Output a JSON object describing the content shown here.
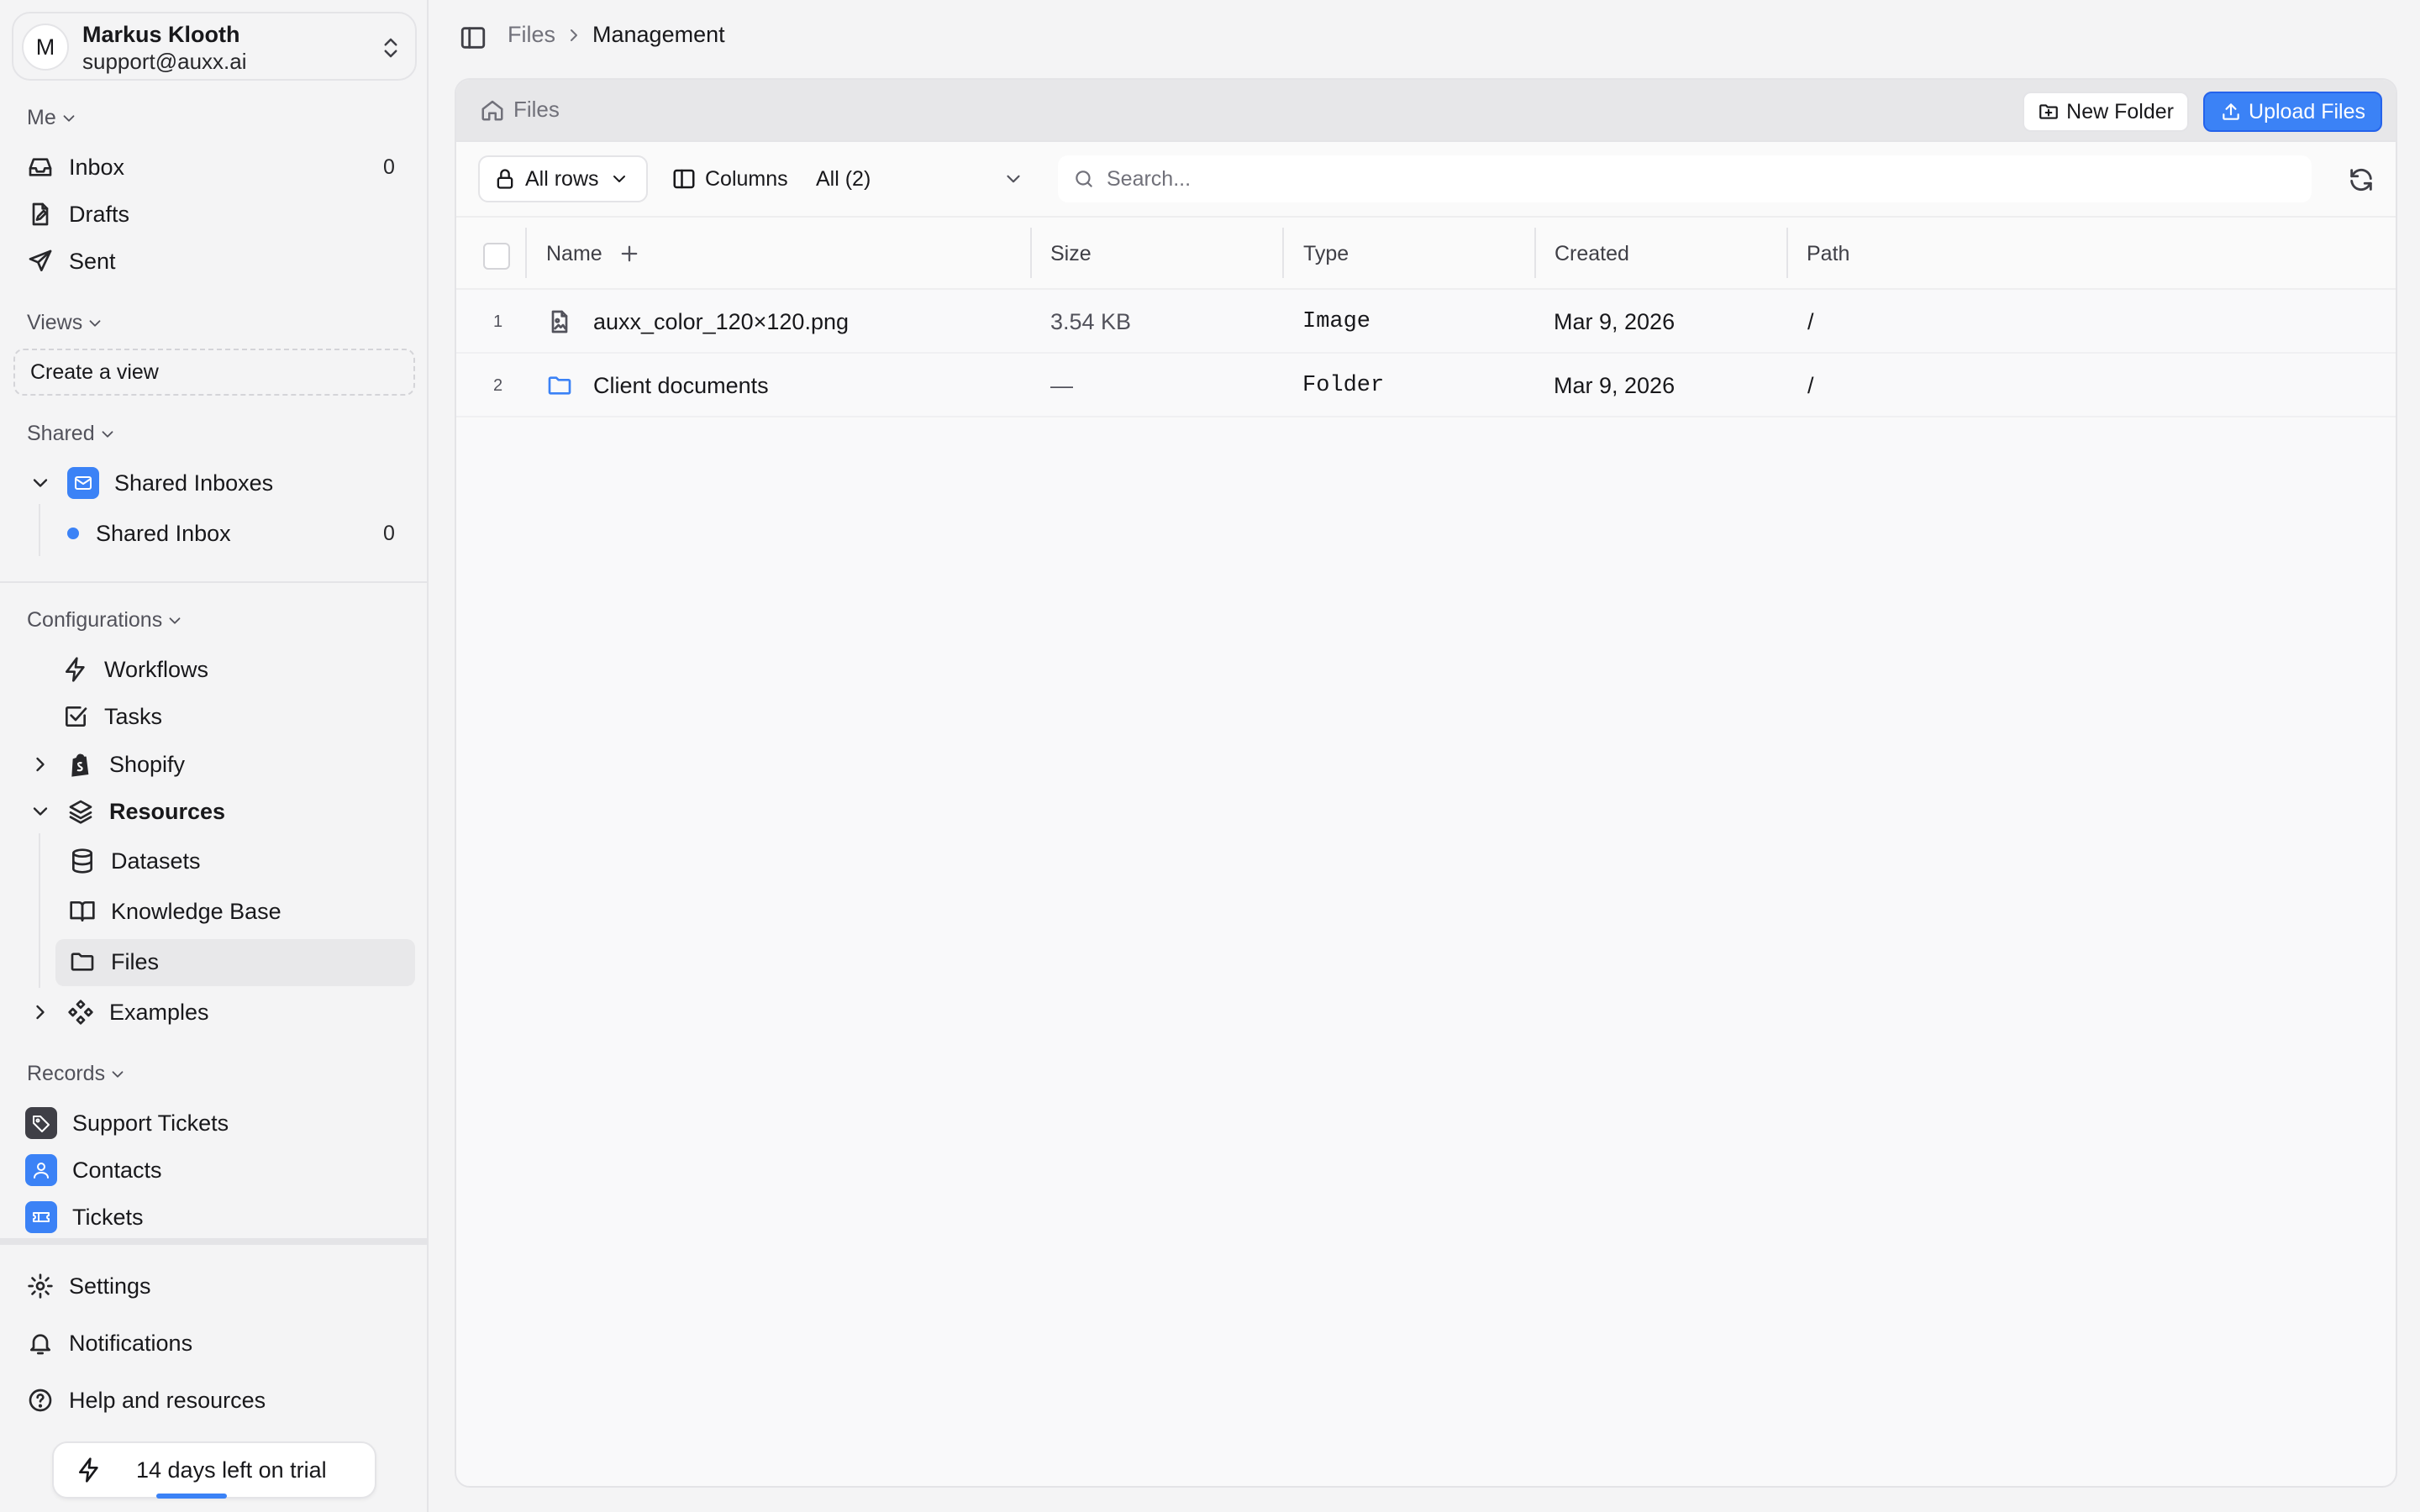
{
  "user": {
    "initial": "M",
    "name": "Markus Klooth",
    "email": "support@auxx.ai"
  },
  "sections": {
    "me": "Me",
    "views": "Views",
    "shared": "Shared",
    "configurations": "Configurations",
    "records": "Records"
  },
  "me_items": [
    {
      "label": "Inbox",
      "count": "0",
      "icon": "inbox-icon"
    },
    {
      "label": "Drafts",
      "icon": "draft-icon"
    },
    {
      "label": "Sent",
      "icon": "send-icon"
    }
  ],
  "create_view": "Create a view",
  "shared": {
    "group": "Shared Inboxes",
    "inbox": "Shared Inbox",
    "inbox_count": "0"
  },
  "config_items": {
    "workflows": "Workflows",
    "tasks": "Tasks",
    "shopify": "Shopify",
    "resources": "Resources",
    "datasets": "Datasets",
    "knowledge_base": "Knowledge Base",
    "files": "Files",
    "examples": "Examples"
  },
  "records": {
    "support_tickets": "Support Tickets",
    "contacts": "Contacts",
    "tickets": "Tickets"
  },
  "footer": {
    "settings": "Settings",
    "notifications": "Notifications",
    "help": "Help and resources",
    "trial": "14 days left on trial"
  },
  "breadcrumb": {
    "root": "Files",
    "current": "Management"
  },
  "panel": {
    "title": "Files",
    "new_folder": "New Folder",
    "upload": "Upload Files"
  },
  "toolbar": {
    "all_rows": "All rows",
    "columns": "Columns",
    "filter": "All (2)",
    "search_placeholder": "Search..."
  },
  "columns": {
    "name": "Name",
    "size": "Size",
    "type": "Type",
    "created": "Created",
    "path": "Path"
  },
  "rows": [
    {
      "num": "1",
      "name": "auxx_color_120×120.png",
      "size": "3.54 KB",
      "type": "Image",
      "created": "Mar 9, 2026",
      "path": "/",
      "icon": "image-file-icon"
    },
    {
      "num": "2",
      "name": "Client documents",
      "size": "—",
      "type": "Folder",
      "created": "Mar 9, 2026",
      "path": "/",
      "icon": "folder-icon"
    }
  ],
  "colors": {
    "accent": "#3b82f6",
    "sidebar_bg": "#f4f4f5",
    "panel_bg": "#f9f9fa"
  }
}
